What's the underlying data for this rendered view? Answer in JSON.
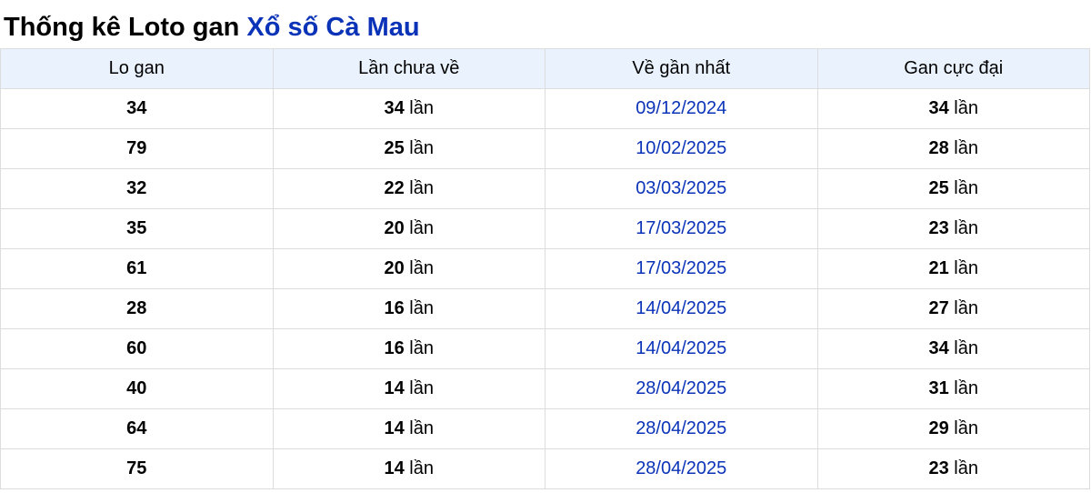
{
  "title": {
    "prefix": "Thống kê Loto gan",
    "link": "Xổ số Cà Mau"
  },
  "colors": {
    "link": "#0a33b8",
    "header_bg": "#eaf3fd",
    "border": "#dcdcdc"
  },
  "table": {
    "headers": [
      "Lo gan",
      "Lần chưa về",
      "Về gần nhất",
      "Gan cực đại"
    ],
    "unit": "lần",
    "rows": [
      {
        "lo": "34",
        "chua_ve": "34",
        "gan_nhat": "09/12/2024",
        "cuc_dai": "34"
      },
      {
        "lo": "79",
        "chua_ve": "25",
        "gan_nhat": "10/02/2025",
        "cuc_dai": "28"
      },
      {
        "lo": "32",
        "chua_ve": "22",
        "gan_nhat": "03/03/2025",
        "cuc_dai": "25"
      },
      {
        "lo": "35",
        "chua_ve": "20",
        "gan_nhat": "17/03/2025",
        "cuc_dai": "23"
      },
      {
        "lo": "61",
        "chua_ve": "20",
        "gan_nhat": "17/03/2025",
        "cuc_dai": "21"
      },
      {
        "lo": "28",
        "chua_ve": "16",
        "gan_nhat": "14/04/2025",
        "cuc_dai": "27"
      },
      {
        "lo": "60",
        "chua_ve": "16",
        "gan_nhat": "14/04/2025",
        "cuc_dai": "34"
      },
      {
        "lo": "40",
        "chua_ve": "14",
        "gan_nhat": "28/04/2025",
        "cuc_dai": "31"
      },
      {
        "lo": "64",
        "chua_ve": "14",
        "gan_nhat": "28/04/2025",
        "cuc_dai": "29"
      },
      {
        "lo": "75",
        "chua_ve": "14",
        "gan_nhat": "28/04/2025",
        "cuc_dai": "23"
      }
    ]
  }
}
